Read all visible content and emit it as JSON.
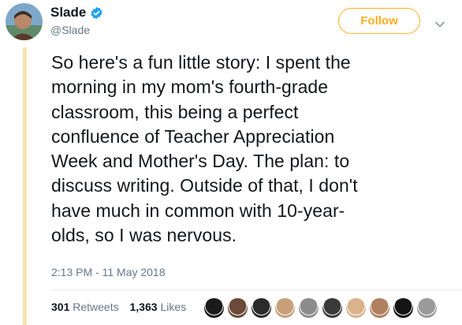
{
  "tweet": {
    "author": {
      "display_name": "Slade",
      "handle": "@Slade",
      "verified": true,
      "avatar_icon": "profile-photo"
    },
    "follow_label": "Follow",
    "text_lines": [
      "So here's a fun little story: I spent the",
      "morning in my mom's fourth-grade",
      "classroom, this being a perfect",
      "confluence of Teacher Appreciation",
      "Week and Mother's Day. The plan: to",
      "discuss writing. Outside of that, I don't",
      "have much in common with 10-year-",
      "olds, so I was nervous."
    ],
    "timestamp": "2:13 PM - 11 May 2018",
    "retweets": {
      "count": "301",
      "label": "Retweets"
    },
    "likes": {
      "count": "1,363",
      "label": "Likes"
    },
    "liker_avatars": [
      {
        "color": "#1a1a1a"
      },
      {
        "color": "#6b4a3a"
      },
      {
        "color": "#2b2b2b"
      },
      {
        "color": "#c7a07a"
      },
      {
        "color": "#8c8c8c"
      },
      {
        "color": "#3a3a3a"
      },
      {
        "color": "#d9b38c"
      },
      {
        "color": "#b08060"
      },
      {
        "color": "#151515"
      },
      {
        "color": "#9a9a9a"
      }
    ]
  },
  "colors": {
    "accent": "#ffad1f",
    "thread_line": "#f5e3b3",
    "verified": "#1da1f2",
    "muted_text": "#657786"
  }
}
